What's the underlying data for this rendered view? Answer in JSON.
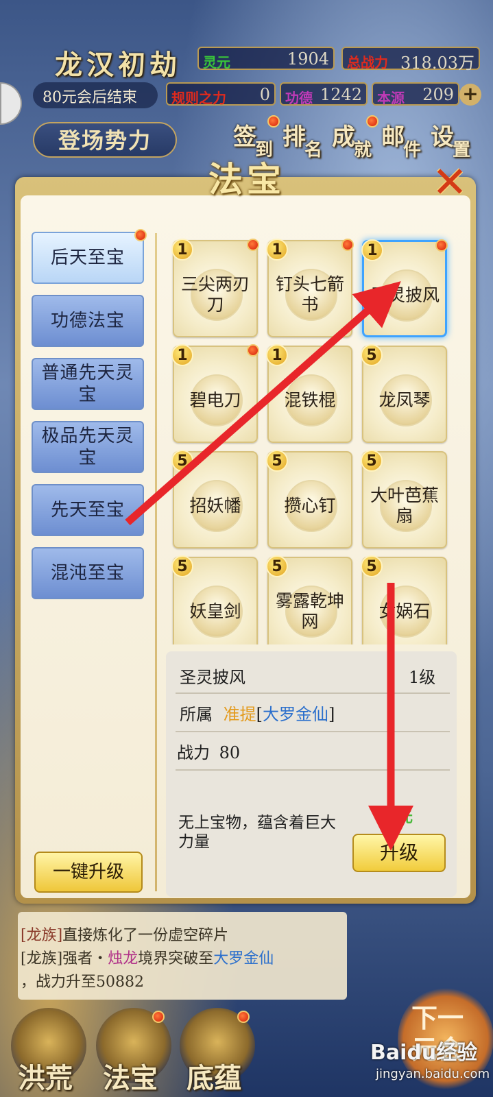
{
  "hud": {
    "realm_title": "龙汉初劫",
    "countdown": "80元会后结束",
    "stats": [
      {
        "label": "灵元",
        "value": "1904",
        "color": "#39c43a"
      },
      {
        "label": "总战力",
        "value": "318.03万",
        "color": "#e02a1d"
      },
      {
        "label": "规则之力",
        "value": "0",
        "color": "#e02a1d"
      },
      {
        "label": "功德",
        "value": "1242",
        "color": "#c03ab7"
      },
      {
        "label": "本源",
        "value": "209",
        "color": "#c03ab7"
      }
    ],
    "faction_button": "登场势力",
    "top_buttons": [
      {
        "c1": "签",
        "c2": "到",
        "badge": true
      },
      {
        "c1": "排",
        "c2": "名",
        "badge": false
      },
      {
        "c1": "成",
        "c2": "就",
        "badge": true
      },
      {
        "c1": "邮",
        "c2": "件",
        "badge": false
      },
      {
        "c1": "设",
        "c2": "置",
        "badge": false
      }
    ]
  },
  "panel": {
    "title": "法宝",
    "close_icon": "close-x-icon",
    "tabs": [
      {
        "label": "后天至宝",
        "active": true,
        "badge": true
      },
      {
        "label": "功德法宝",
        "active": false,
        "badge": false
      },
      {
        "label": "普通先天灵宝",
        "active": false,
        "badge": false
      },
      {
        "label": "极品先天灵宝",
        "active": false,
        "badge": false
      },
      {
        "label": "先天至宝",
        "active": false,
        "badge": false
      },
      {
        "label": "混沌至宝",
        "active": false,
        "badge": false
      }
    ],
    "items": [
      {
        "name": "三尖两刃刀",
        "level": "1",
        "badge": true,
        "selected": false
      },
      {
        "name": "钉头七箭书",
        "level": "1",
        "badge": true,
        "selected": false
      },
      {
        "name": "圣灵披风",
        "level": "1",
        "badge": true,
        "selected": true
      },
      {
        "name": "碧电刀",
        "level": "1",
        "badge": true,
        "selected": false
      },
      {
        "name": "混铁棍",
        "level": "1",
        "badge": false,
        "selected": false
      },
      {
        "name": "龙凤琴",
        "level": "5",
        "badge": false,
        "selected": false
      },
      {
        "name": "招妖幡",
        "level": "5",
        "badge": false,
        "selected": false
      },
      {
        "name": "攒心钉",
        "level": "5",
        "badge": false,
        "selected": false
      },
      {
        "name": "大叶芭蕉扇",
        "level": "5",
        "badge": false,
        "selected": false
      },
      {
        "name": "妖皇剑",
        "level": "5",
        "badge": false,
        "selected": false
      },
      {
        "name": "雾露乾坤网",
        "level": "5",
        "badge": false,
        "selected": false
      },
      {
        "name": "女娲石",
        "level": "5",
        "badge": false,
        "selected": false
      }
    ],
    "detail": {
      "name": "圣灵披风",
      "level": "1级",
      "owner_label": "所属",
      "owner_name": "准提",
      "owner_rank_open": "[",
      "owner_rank": "大罗金仙",
      "owner_rank_close": "]",
      "power_label": "战力",
      "power_value": "80",
      "description": "无上宝物，蕴含着巨大力量",
      "cost_label": "灵元",
      "upgrade_button": "升级"
    },
    "one_click_upgrade": "一键升级"
  },
  "chat": [
    {
      "tag": "[龙族]",
      "text": "直接炼化了一份虚空碎片"
    },
    {
      "tag": "[龙族]",
      "pre": "强者・",
      "name": "烛龙",
      "mid": "境界突破至",
      "rank": "大罗金仙"
    },
    {
      "text": "，战力升至50882"
    }
  ],
  "bottom_nav": [
    {
      "label": "洪荒",
      "badge": false
    },
    {
      "label": "法宝",
      "badge": true
    },
    {
      "label": "底蕴",
      "badge": true
    }
  ],
  "next_button": {
    "line1": "下一",
    "line2": "元会"
  },
  "watermark": {
    "brand": "Baidu经验",
    "url": "jingyan.baidu.com"
  },
  "colors": {
    "panel_bg": "#f7f0dc",
    "tab_blue": "#7d9ddc",
    "selected_border": "#3ea3ff",
    "arrow_red": "#e8262a",
    "owner_orange": "#e39a1c",
    "rank_blue": "#2b6fcc"
  }
}
